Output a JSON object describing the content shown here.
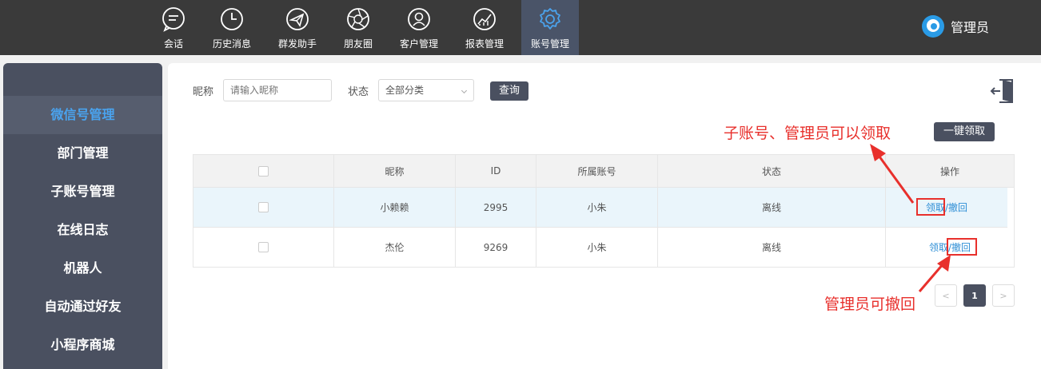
{
  "topnav": {
    "items": [
      {
        "label": "会话",
        "icon": "chat-icon"
      },
      {
        "label": "历史消息",
        "icon": "clock-icon"
      },
      {
        "label": "群发助手",
        "icon": "send-icon"
      },
      {
        "label": "朋友圈",
        "icon": "aperture-icon"
      },
      {
        "label": "客户管理",
        "icon": "user-icon"
      },
      {
        "label": "报表管理",
        "icon": "chart-icon"
      },
      {
        "label": "账号管理",
        "icon": "gear-icon",
        "active": true
      }
    ],
    "user_name": "管理员"
  },
  "sidebar": {
    "items": [
      {
        "label": "微信号管理",
        "active": true
      },
      {
        "label": "部门管理"
      },
      {
        "label": "子账号管理"
      },
      {
        "label": "在线日志"
      },
      {
        "label": "机器人"
      },
      {
        "label": "自动通过好友"
      },
      {
        "label": "小程序商城"
      }
    ]
  },
  "filter": {
    "nickname_label": "昵称",
    "nickname_placeholder": "请输入昵称",
    "status_label": "状态",
    "status_value": "全部分类",
    "query_button": "查询"
  },
  "claim_all_button": "一键领取",
  "table": {
    "headers": [
      "昵称",
      "ID",
      "所属账号",
      "状态",
      "操作"
    ],
    "rows": [
      {
        "nickname": "小赖赖",
        "id": "2995",
        "account": "小朱",
        "status": "离线",
        "action_claim": "领取",
        "action_sep": "/",
        "action_revoke": "撤回"
      },
      {
        "nickname": "杰伦",
        "id": "9269",
        "account": "小朱",
        "status": "离线",
        "action_claim": "领取",
        "action_sep": "/",
        "action_revoke": "撤回"
      }
    ]
  },
  "pagination": {
    "prev": "<",
    "current": "1",
    "next": ">"
  },
  "annotations": {
    "note_claim": "子账号、管理员可以领取",
    "note_revoke": "管理员可撤回"
  },
  "colors": {
    "accent": "#4aa3ee",
    "annotation_red": "#e8302c",
    "dark": "#4a5060",
    "link": "#2f8fd6"
  }
}
